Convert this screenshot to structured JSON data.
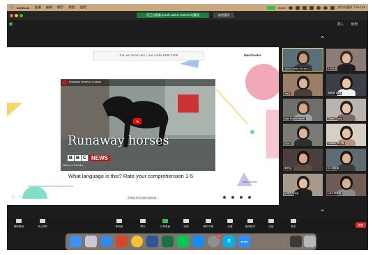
{
  "menubar": {
    "app": "zoom.us",
    "items": [
      "會議",
      "編輯",
      "顯示",
      "視窗",
      "說明"
    ],
    "zoom_label": "zoom",
    "datetime": "3月21週四 下午4:18"
  },
  "titlebar": {
    "banner": "您正在觀看 Jacob Ladem Gurzon 的畫面",
    "view_options": "檢視選項"
  },
  "view_controls": {
    "enter": "進入",
    "view": "檢視"
  },
  "slide": {
    "join_text": "Join at menti.com | use code  4485 1105",
    "brand": "Mentimeter",
    "video_title": "Runaway horses in London",
    "headline": "Runaway horses",
    "bbc_letters": [
      "B",
      "B",
      "C"
    ],
    "news": "NEWS",
    "watch_on": "Watch on YouTube",
    "question": "What language is this? Rate your comprehension 1-5",
    "add_later": "add to Home",
    "bottom_bar": "Press H to hide controls",
    "prev": "←",
    "next": "→"
  },
  "participants": [
    {
      "name": "Jacob Laden Gurzon",
      "active": true,
      "bg": "#5b6f7a",
      "skin": "#c89c7a",
      "hair": "#2a2420",
      "shirt": "#3a3a3a"
    },
    {
      "name": "Y. Kim",
      "active": false,
      "bg": "#8d7c76",
      "skin": "#e0b8a0",
      "hair": "#3a2a22",
      "shirt": "#1f1f1f"
    },
    {
      "name": "Jessi",
      "active": false,
      "bg": "#9a7f67",
      "skin": "#d9b59a",
      "hair": "#211a16",
      "shirt": "#4a3f36"
    },
    {
      "name": "鄭雅晴 Doris",
      "active": false,
      "bg": "#3c3f46",
      "skin": "#e8c3a8",
      "hair": "#1c1512",
      "shirt": "#f2f2f2"
    },
    {
      "name": "Max Rosenwasser",
      "active": false,
      "bg": "#6e6e6a",
      "skin": "#d3a98c",
      "hair": "#3a2c20",
      "shirt": "#9aa3a6"
    },
    {
      "name": "Chloe Chang",
      "active": false,
      "bg": "#b9b4ad",
      "skin": "#e7c6ad",
      "hair": "#2a1f1a",
      "shirt": "#7d6c5f"
    },
    {
      "name": "Alice",
      "active": false,
      "bg": "#7a7a76",
      "skin": "#dcb79c",
      "hair": "#241c17",
      "shirt": "#2f2f2f"
    },
    {
      "name": "Cataste 蔡佳穎",
      "active": false,
      "bg": "#d8cfc4",
      "skin": "#e7c3a6",
      "hair": "#1e1714",
      "shirt": "#b88f7a"
    },
    {
      "name": "陳宜芸",
      "active": false,
      "bg": "#4a3f3a",
      "skin": "#d7a989",
      "hair": "#191310",
      "shirt": "#5a4a40"
    },
    {
      "name": "Ivy 林家瑜",
      "active": false,
      "bg": "#5e6b73",
      "skin": "#ddb597",
      "hair": "#1d1613",
      "shirt": "#3b3b3b"
    },
    {
      "name": "紀翊恩Peggy",
      "active": false,
      "bg": "#a59a8c",
      "skin": "#e2bfa4",
      "hair": "#221a16",
      "shirt": "#1e1e1e"
    },
    {
      "name": "Cora 李佩蓉",
      "active": false,
      "bg": "#6f5d55",
      "skin": "#d9b092",
      "hair": "#1b1411",
      "shirt": "#8a8a8a"
    }
  ],
  "toolbar": {
    "audio": "解除靜音",
    "video": "停止視訊",
    "participants": "參與者",
    "participants_count": "22",
    "chat": "聊天",
    "share": "分享畫面",
    "record": "錄製",
    "captions": "顯示字幕",
    "reactions": "反應",
    "apps": "應用程式",
    "whiteboard": "白板",
    "more": "更多",
    "end": "離開"
  },
  "dock": {
    "items": [
      "finder-icon",
      "launchpad-icon",
      "safari-icon",
      "powerpoint-icon",
      "chrome-icon",
      "word-icon",
      "excel-icon",
      "line-icon",
      "appstore-icon",
      "settings-icon",
      "skype-icon",
      "zoom-icon",
      "screen-icon",
      "trash-icon"
    ],
    "settings_badge": "1",
    "zoom_label": "zoom",
    "skype_label": "S"
  },
  "colors": {
    "accent_green": "#2fc15a",
    "end_red": "#e02828",
    "menubar": "#c9a77f",
    "bbc_red": "#bb1919"
  }
}
